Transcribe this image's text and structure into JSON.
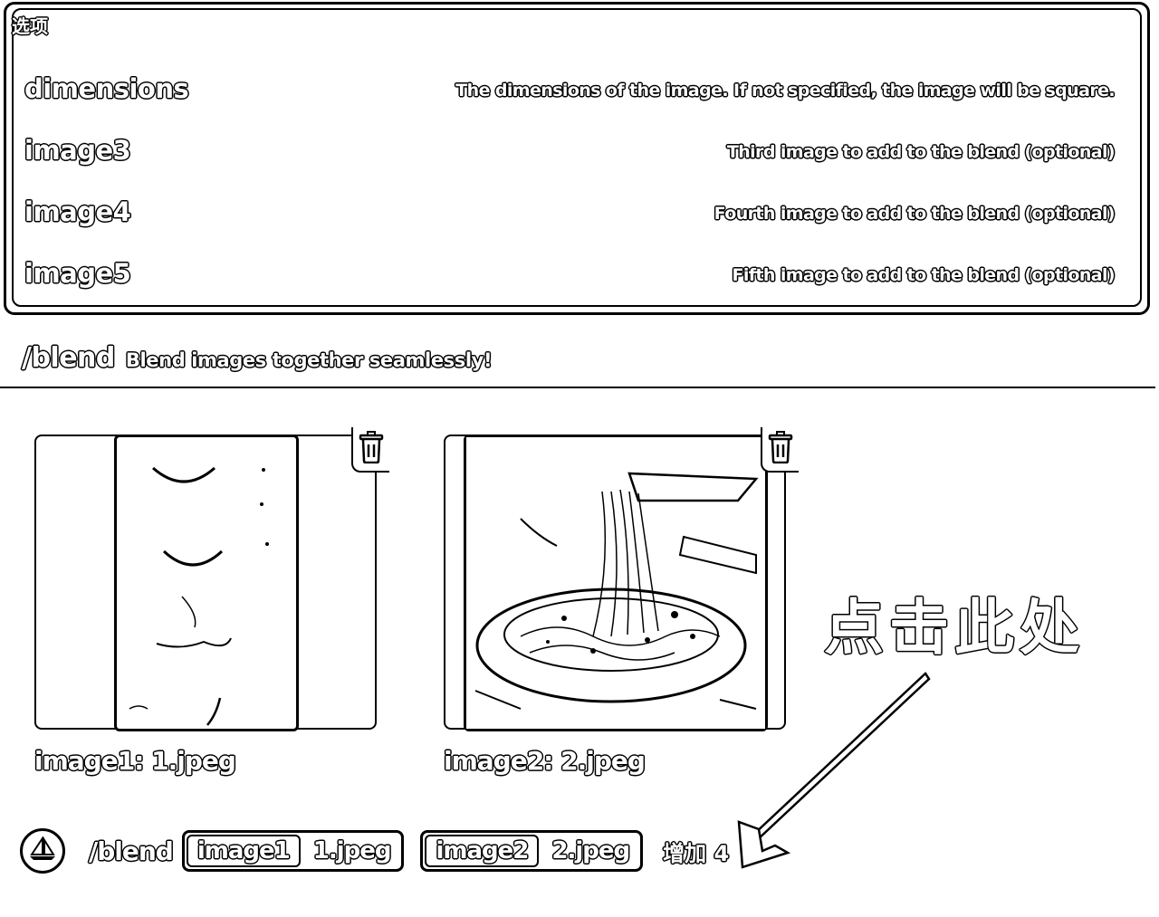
{
  "options": {
    "title": "选项",
    "items": [
      {
        "name": "dimensions",
        "desc": "The dimensions of the image. If not specified, the image will be square."
      },
      {
        "name": "image3",
        "desc": "Third image to add to the blend (optional)"
      },
      {
        "name": "image4",
        "desc": "Fourth image to add to the blend (optional)"
      },
      {
        "name": "image5",
        "desc": "Fifth image to add to the blend (optional)"
      }
    ]
  },
  "command": {
    "name": "/blend",
    "description": "Blend images together seamlessly!"
  },
  "attachments": [
    {
      "caption": "image1: 1.jpeg",
      "icon": "trash-icon"
    },
    {
      "caption": "image2: 2.jpeg",
      "icon": "trash-icon"
    }
  ],
  "command_bar": {
    "command": "/blend",
    "params": [
      {
        "key": "image1",
        "value": "1.jpeg"
      },
      {
        "key": "image2",
        "value": "2.jpeg"
      }
    ],
    "more": "增加 4"
  },
  "annotation": {
    "text": "点击此处"
  }
}
